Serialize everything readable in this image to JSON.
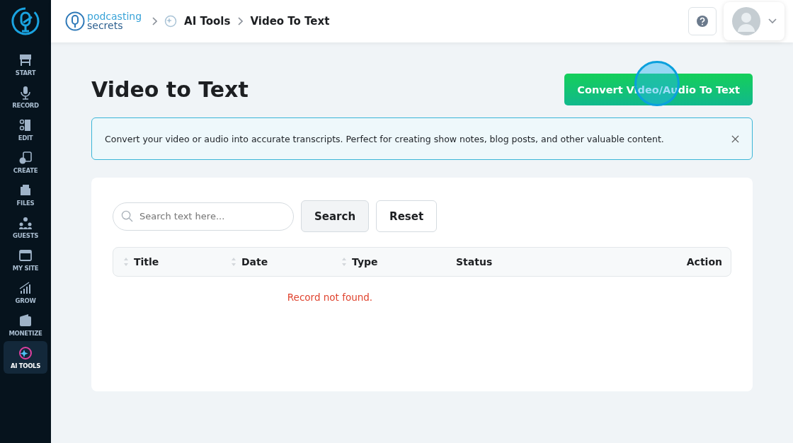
{
  "sidebar": {
    "items": [
      {
        "label": "START",
        "selected": false
      },
      {
        "label": "RECORD",
        "selected": false
      },
      {
        "label": "EDIT",
        "selected": false
      },
      {
        "label": "CREATE",
        "selected": false
      },
      {
        "label": "FILES",
        "selected": false
      },
      {
        "label": "GUESTS",
        "selected": false
      },
      {
        "label": "MY SITE",
        "selected": false
      },
      {
        "label": "GROW",
        "selected": false
      },
      {
        "label": "MONETIZE",
        "selected": false
      },
      {
        "label": "AI TOOLS",
        "selected": true
      }
    ]
  },
  "header": {
    "logo": [
      "podcasting",
      "secrets"
    ],
    "breadcrumbs": [
      "AI Tools",
      "Video To Text"
    ]
  },
  "page": {
    "title": "Video to Text",
    "primary_button": "Convert Video/Audio To Text",
    "notice": {
      "text": "Convert your video or audio into accurate transcripts. Perfect for creating show notes, blog posts, and other valuable content."
    },
    "search": {
      "placeholder": "Search text here...",
      "buttons": [
        "Search",
        "Reset"
      ]
    },
    "table": {
      "columns": [
        {
          "label": "Title",
          "sortable": true
        },
        {
          "label": "Date",
          "sortable": true
        },
        {
          "label": "Type",
          "sortable": true
        },
        {
          "label": "Status",
          "sortable": false
        },
        {
          "label": "Action",
          "sortable": false
        }
      ],
      "empty_message": "Record not found."
    }
  }
}
